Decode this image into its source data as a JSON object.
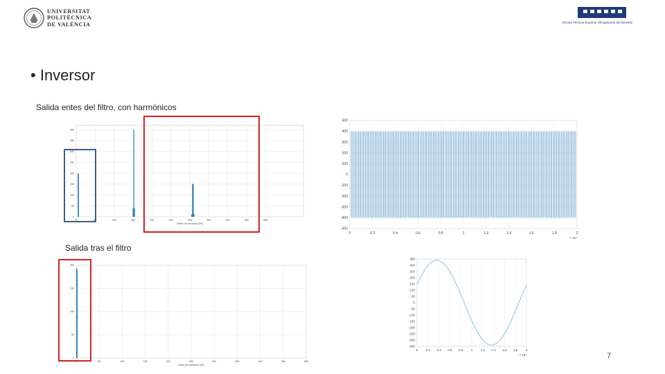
{
  "header": {
    "upv_logo_lines": [
      "UNIVERSITAT",
      "POLITÈCNICA",
      "DE VALÈNCIA"
    ],
    "etsi_logo_caption": "Escola Tècnica Superior d'Enginyeria del Disseny"
  },
  "slide": {
    "bullet_title": "Inversor",
    "caption_before": "Salida entes del filtro, con harmónicos",
    "caption_after": "Salida tras el filtro",
    "page_number": "7",
    "highlight_colors": {
      "red": "#d62020",
      "blue": "#3d5f86"
    },
    "plot_color": "#1f77b4",
    "sine_color": "#8fbfdc"
  },
  "chart_data": [
    {
      "type": "bar",
      "description_role": "harmonic spectrum before filter",
      "xlabel": "Orden de armónico (f/f₁)",
      "ylabel": "",
      "xlim": [
        0,
        600
      ],
      "ylim": [
        0,
        420
      ],
      "xticks": [
        0,
        50,
        100,
        150,
        200,
        250,
        300,
        350,
        400,
        450,
        500
      ],
      "yticks": [
        0,
        50,
        100,
        150,
        200,
        250,
        300,
        350,
        400
      ],
      "bars": [
        {
          "x": 5,
          "y": 200
        },
        {
          "x": 6,
          "y": 195
        },
        {
          "x": 150,
          "y": 38
        },
        {
          "x": 152,
          "y": 400
        },
        {
          "x": 154,
          "y": 38
        },
        {
          "x": 305,
          "y": 12
        },
        {
          "x": 307,
          "y": 150
        },
        {
          "x": 309,
          "y": 152
        },
        {
          "x": 311,
          "y": 12
        }
      ],
      "grid": true
    },
    {
      "type": "line",
      "description_role": "PWM inverter output before filter",
      "xlim": [
        0,
        2
      ],
      "ylim": [
        -500,
        500
      ],
      "xticks": [
        "0",
        "0.2",
        "0.4",
        "0.6",
        "0.8",
        "1",
        "1.2",
        "1.4",
        "1.6",
        "1.8",
        "2"
      ],
      "yticks": [
        "500",
        "400",
        "300",
        "200",
        "100",
        "0",
        "-100",
        "-200",
        "-300",
        "-400",
        "-500"
      ],
      "x_multiplier": "× 10⁴",
      "levels": [
        400,
        -400
      ],
      "grid": true
    },
    {
      "type": "bar",
      "description_role": "harmonic spectrum after filter",
      "xlabel": "Orden de armónico (f/f₁)",
      "ylabel": "",
      "xlim": [
        0,
        500
      ],
      "ylim": [
        0,
        200
      ],
      "xticks": [
        0,
        50,
        100,
        150,
        200,
        250,
        300,
        350,
        400,
        450,
        500
      ],
      "yticks": [
        0,
        50,
        100,
        150,
        200
      ],
      "bars": [
        {
          "x": 1,
          "y": 194
        },
        {
          "x": 2,
          "y": 190
        }
      ],
      "grid": true
    },
    {
      "type": "line",
      "description_role": "sinusoidal output after filter",
      "xlim": [
        0,
        2
      ],
      "ylim": [
        -350,
        350
      ],
      "xticks": [
        "0",
        "0.2",
        "0.4",
        "0.6",
        "0.8",
        "1",
        "1.2",
        "1.4",
        "1.6",
        "1.8",
        "2"
      ],
      "yticks": [
        "350",
        "300",
        "250",
        "200",
        "150",
        "100",
        "50",
        "0",
        "-50",
        "-100",
        "-150",
        "-200",
        "-250",
        "-300",
        "-350"
      ],
      "x_multiplier": "× 10⁴",
      "amplitude": 340,
      "period": 2.0,
      "phase_deg": 25,
      "grid": true
    }
  ]
}
